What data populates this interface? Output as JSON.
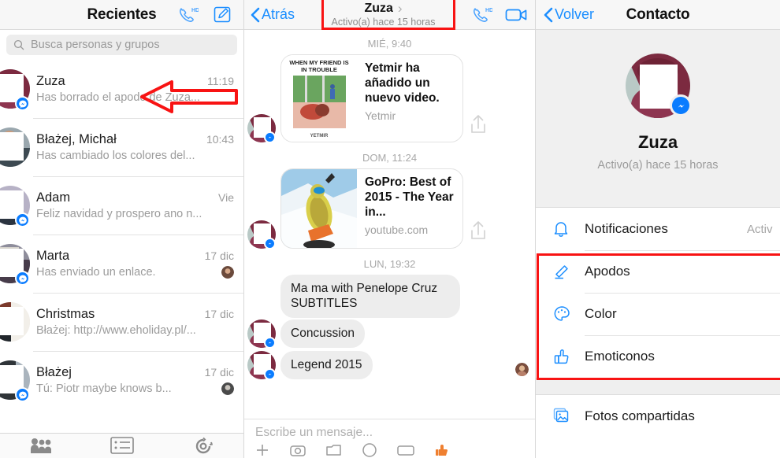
{
  "left_panel": {
    "title": "Recientes",
    "icons": [
      {
        "name": "phone-hd-icon",
        "label": "HD"
      },
      {
        "name": "compose-icon",
        "label": ""
      }
    ],
    "search": {
      "placeholder": "Busca personas y grupos",
      "icon": "search-icon"
    },
    "conversations": [
      {
        "name": "Zuza",
        "time": "11:19",
        "snippet": "Has borrado el apodo de Zuza...",
        "badge": true,
        "seen": false
      },
      {
        "name": "Błażej, Michał",
        "time": "10:43",
        "snippet": "Has cambiado los colores del...",
        "badge": false,
        "seen": false
      },
      {
        "name": "Adam",
        "time": "Vie",
        "snippet": "Feliz navidad y prospero ano n...",
        "badge": true,
        "seen": false
      },
      {
        "name": "Marta",
        "time": "17 dic",
        "snippet": "Has enviado un enlace.",
        "badge": true,
        "seen": true
      },
      {
        "name": "Christmas",
        "time": "17 dic",
        "snippet": "Błażej: http://www.eholiday.pl/...",
        "badge": false,
        "seen": false
      },
      {
        "name": "Błażej",
        "time": "17 dic",
        "snippet": "Tú: Piotr maybe knows b...",
        "badge": true,
        "seen": true
      }
    ],
    "tabbar": [
      {
        "name": "people-tab-icon"
      },
      {
        "name": "list-tab-icon"
      },
      {
        "name": "settings-gear-tab-icon"
      }
    ]
  },
  "middle_panel": {
    "back_label": "Atrás",
    "contact_name": "Zuza",
    "contact_status": "Activo(a) hace 15 horas",
    "chevron": "›",
    "icons": [
      {
        "name": "phone-hd-icon",
        "label": "HD"
      },
      {
        "name": "video-call-icon",
        "label": ""
      }
    ],
    "thread": [
      {
        "kind": "daysep",
        "text": "MIÉ, 9:40"
      },
      {
        "kind": "card",
        "title": "Yetmir ha añadido un nuevo video.",
        "source": "Yetmir",
        "thumb_caption": "WHEN MY FRIEND IS IN TROUBLE",
        "thumb_brand": "YETMIR"
      },
      {
        "kind": "daysep",
        "text": "DOM, 11:24"
      },
      {
        "kind": "card",
        "title": "GoPro: Best of 2015 - The Year in...",
        "source": "youtube.com"
      },
      {
        "kind": "daysep",
        "text": "LUN, 19:32"
      },
      {
        "kind": "bubble",
        "text": "Ma ma with Penelope Cruz SUBTITLES",
        "avatar": false
      },
      {
        "kind": "bubble",
        "text": "Concussion",
        "avatar": true
      },
      {
        "kind": "bubble",
        "text": "Legend 2015",
        "avatar": true,
        "reaction": true
      }
    ],
    "composer": {
      "placeholder": "Escribe un mensaje...",
      "icons": [
        "plus-icon",
        "camera-icon",
        "photos-icon",
        "sticker-icon",
        "gif-icon",
        "thumbs-up-icon"
      ]
    }
  },
  "right_panel": {
    "back_label": "Volver",
    "title": "Contacto",
    "profile": {
      "name": "Zuza",
      "status": "Activo(a) hace 15 horas",
      "badge": "messenger-badge"
    },
    "rows": [
      {
        "label": "Notificaciones",
        "value": "Activ",
        "icon": "bell-icon"
      },
      {
        "label": "Apodos",
        "value": "",
        "icon": "pencil-icon"
      },
      {
        "label": "Color",
        "value": "",
        "icon": "palette-icon"
      },
      {
        "label": "Emoticonos",
        "value": "",
        "icon": "thumbs-up-icon"
      },
      {
        "label": "Fotos compartidas",
        "value": "",
        "icon": "photos-stack-icon"
      }
    ]
  },
  "annotations": {
    "color": "#f81313",
    "items": [
      {
        "name": "arrow-pointing-to-zuza-conversation",
        "shape": "arrow-left"
      },
      {
        "name": "highlight-box-conversation-header",
        "shape": "rect"
      },
      {
        "name": "highlight-box-customization-options",
        "shape": "rect"
      }
    ]
  }
}
